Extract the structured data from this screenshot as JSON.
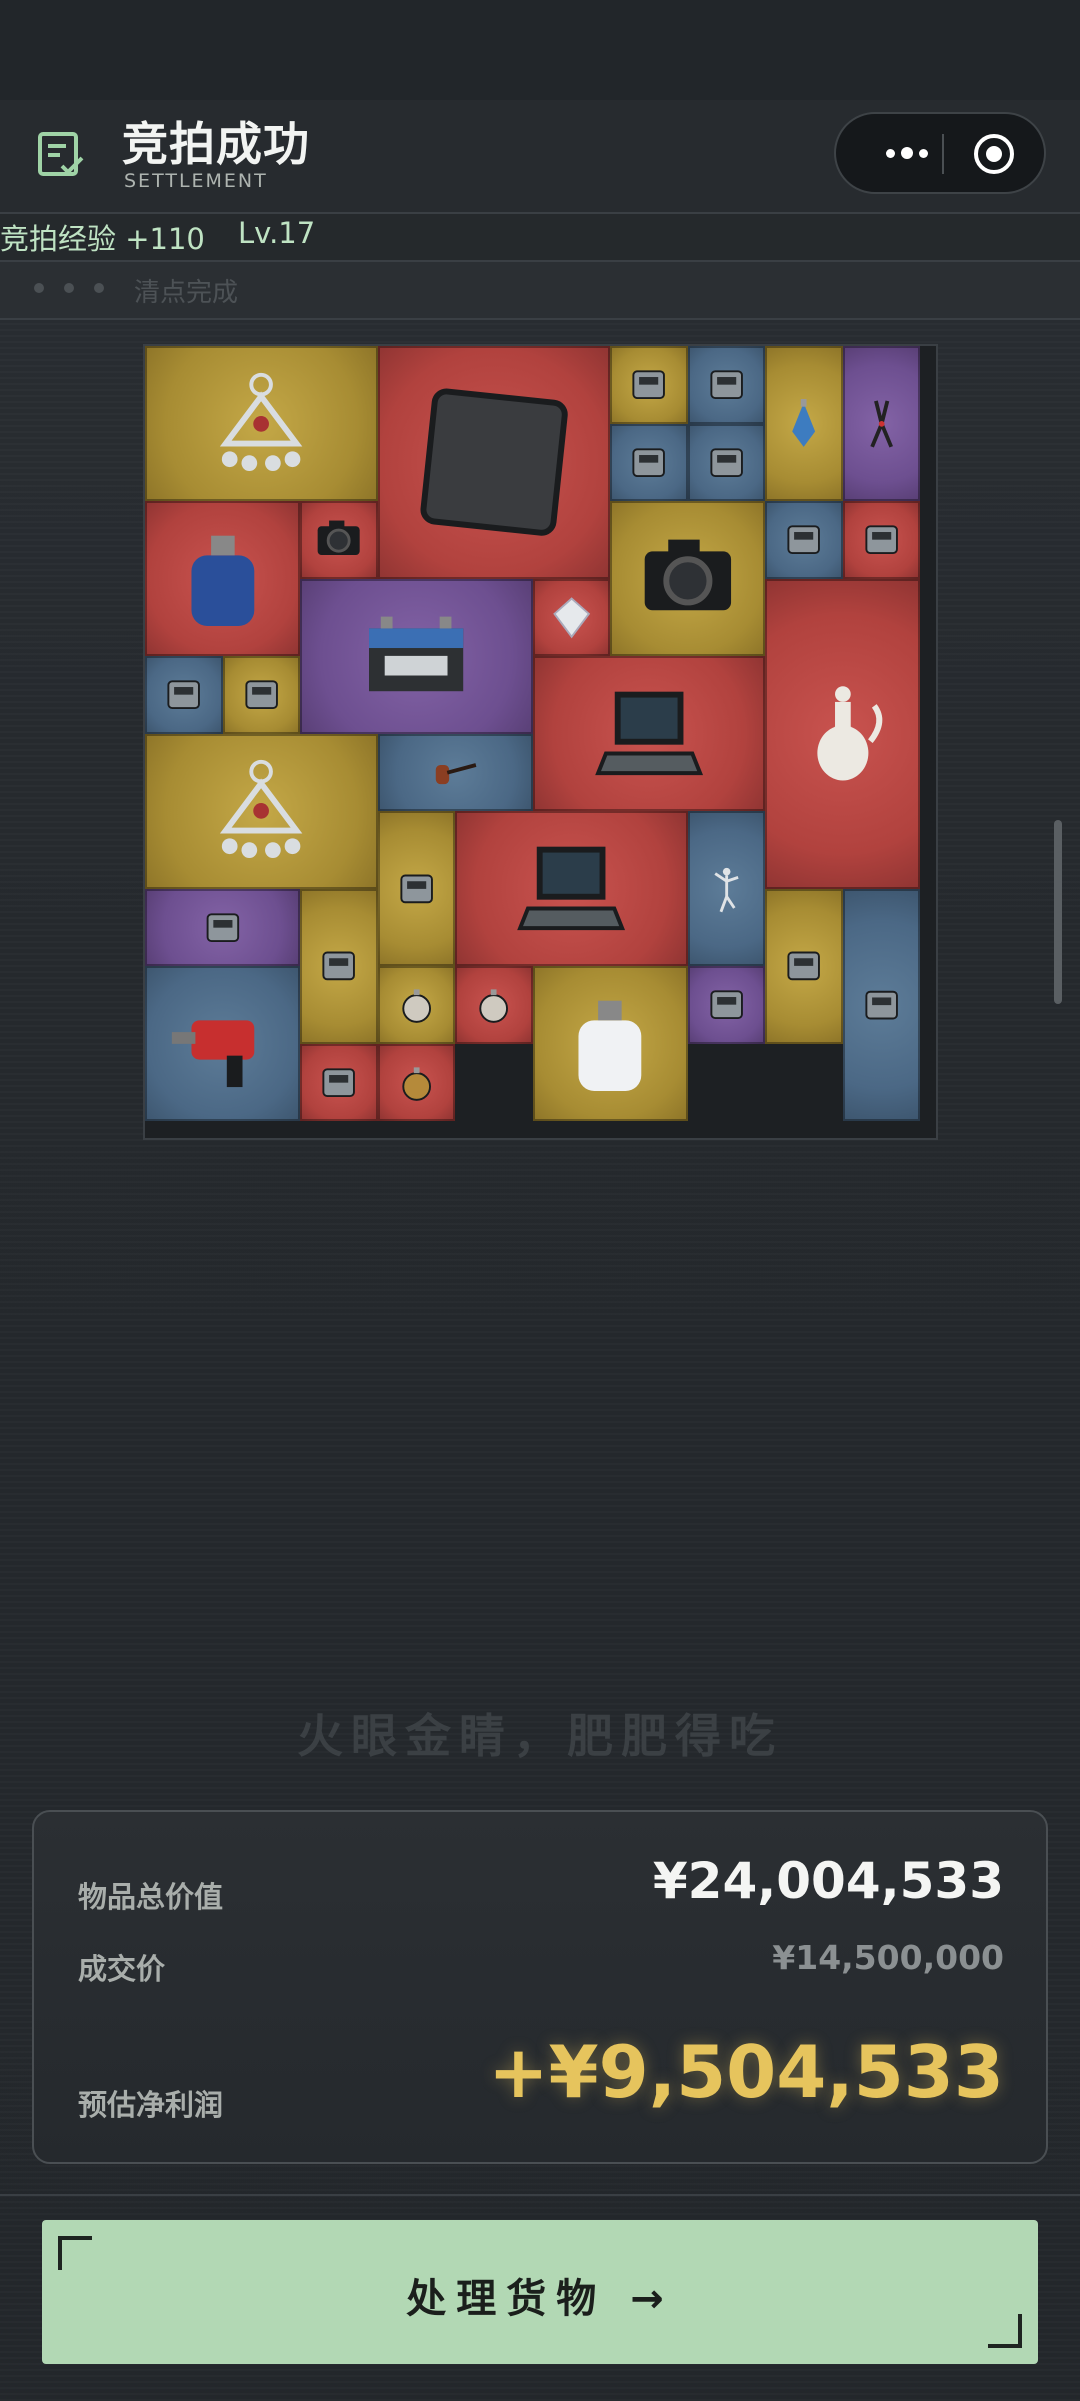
{
  "header": {
    "title": "竞拍成功",
    "subtitle": "SETTLEMENT",
    "icon": "receipt-check-icon"
  },
  "capsule": {
    "more_icon": "more-dots-icon",
    "close_icon": "target-circle-icon"
  },
  "progress": {
    "exp": "竞拍经验 +110",
    "level": "Lv.17",
    "status": "清点完成"
  },
  "items": [
    {
      "name": "amulet-pendant",
      "rarity": "gold"
    },
    {
      "name": "carbon-plate",
      "rarity": "red"
    },
    {
      "name": "ssd-stick",
      "rarity": "gold"
    },
    {
      "name": "cpu-chip",
      "rarity": "blue"
    },
    {
      "name": "perfume-bottle",
      "rarity": "gold"
    },
    {
      "name": "pliers",
      "rarity": "purple"
    },
    {
      "name": "hard-drive",
      "rarity": "blue"
    },
    {
      "name": "ammo-tin",
      "rarity": "blue"
    },
    {
      "name": "gas-canister",
      "rarity": "red"
    },
    {
      "name": "mini-camera",
      "rarity": "red"
    },
    {
      "name": "dslr-camera",
      "rarity": "gold"
    },
    {
      "name": "phone",
      "rarity": "blue"
    },
    {
      "name": "flashlight",
      "rarity": "red"
    },
    {
      "name": "car-battery",
      "rarity": "purple"
    },
    {
      "name": "diamond",
      "rarity": "red"
    },
    {
      "name": "porcelain-ewer",
      "rarity": "red"
    },
    {
      "name": "power-bank",
      "rarity": "blue"
    },
    {
      "name": "gold-bar",
      "rarity": "gold"
    },
    {
      "name": "rugged-laptop",
      "rarity": "red"
    },
    {
      "name": "amulet-pendant-2",
      "rarity": "gold"
    },
    {
      "name": "tobacco-pipe",
      "rarity": "blue"
    },
    {
      "name": "stamp-sheet",
      "rarity": "gold"
    },
    {
      "name": "field-laptop-case",
      "rarity": "red"
    },
    {
      "name": "ballerina-figurine",
      "rarity": "blue"
    },
    {
      "name": "radio",
      "rarity": "purple"
    },
    {
      "name": "leather-journal",
      "rarity": "gold"
    },
    {
      "name": "banknotes",
      "rarity": "gold"
    },
    {
      "name": "server-unit",
      "rarity": "blue"
    },
    {
      "name": "demolition-hammer",
      "rarity": "blue"
    },
    {
      "name": "pocket-watch-silver",
      "rarity": "gold"
    },
    {
      "name": "compass-dial",
      "rarity": "red"
    },
    {
      "name": "fuel-jug",
      "rarity": "gold"
    },
    {
      "name": "tablet",
      "rarity": "purple"
    },
    {
      "name": "circuit-module",
      "rarity": "red"
    },
    {
      "name": "pocket-watch-gold",
      "rarity": "red"
    }
  ],
  "slogan": "火眼金睛，肥肥得吃",
  "summary": {
    "total_label": "物品总价值",
    "total_value": "¥24,004,533",
    "deal_label": "成交价",
    "deal_value": "¥14,500,000",
    "profit_label": "预估净利润",
    "profit_value": "+¥9,504,533"
  },
  "cta": {
    "label": "处理货物 →"
  },
  "colors": {
    "gold": "#b09536",
    "red": "#b5443f",
    "blue": "#4e6b88",
    "purple": "#704f92",
    "accent": "#b2d8b4",
    "profit": "#e6c45d"
  }
}
